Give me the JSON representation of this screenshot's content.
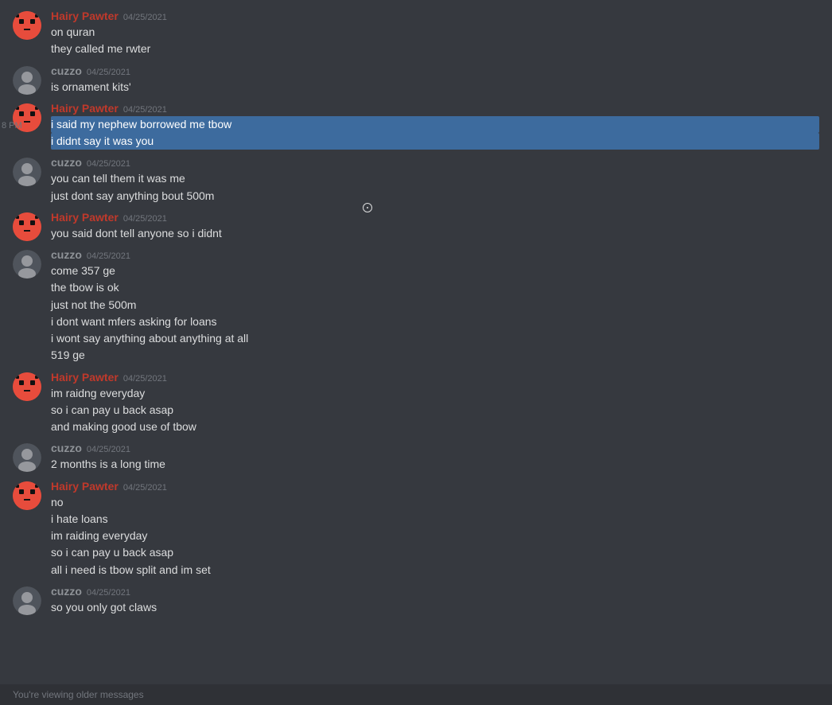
{
  "colors": {
    "bg": "#36393f",
    "sidebar_bg": "#2f3136",
    "text_primary": "#dcddde",
    "text_muted": "#72767d",
    "username_hairy": "#c0392b",
    "username_cuzzo": "#8e9297",
    "selected_bg": "#3d6b9e"
  },
  "messages": [
    {
      "id": "msg1",
      "author": "Hairy Pawter",
      "author_type": "hairy",
      "timestamp": "04/25/2021",
      "lines": [
        "on quran",
        "they called me rwter"
      ]
    },
    {
      "id": "msg2",
      "author": "cuzzo",
      "author_type": "cuzzo",
      "timestamp": "04/25/2021",
      "lines": [
        "is ornament kits'"
      ]
    },
    {
      "id": "msg3",
      "author": "Hairy Pawter",
      "author_type": "hairy",
      "timestamp": "04/25/2021",
      "lines": [
        "i said my nephew borrowed me tbow",
        "i didnt say it was you"
      ],
      "selected_lines": [
        0,
        1
      ]
    },
    {
      "id": "msg4",
      "author": "cuzzo",
      "author_type": "cuzzo",
      "timestamp": "04/25/2021",
      "lines": [
        "you can tell them it was me",
        "just dont say anything bout 500m"
      ]
    },
    {
      "id": "msg5",
      "author": "Hairy Pawter",
      "author_type": "hairy",
      "timestamp": "04/25/2021",
      "lines": [
        "you said dont tell anyone so i didnt"
      ]
    },
    {
      "id": "msg6",
      "author": "cuzzo",
      "author_type": "cuzzo",
      "timestamp": "04/25/2021",
      "lines": [
        "come 357 ge",
        "the tbow is ok",
        "just not the 500m",
        "i dont want mfers asking for loans",
        "i wont say anything about anything at all",
        "519 ge"
      ]
    },
    {
      "id": "msg7",
      "author": "Hairy Pawter",
      "author_type": "hairy",
      "timestamp": "04/25/2021",
      "lines": [
        "im raidng everyday",
        "so i can pay u back asap",
        "and making good use of tbow"
      ]
    },
    {
      "id": "msg8",
      "author": "cuzzo",
      "author_type": "cuzzo",
      "timestamp": "04/25/2021",
      "lines": [
        "2 months is a long time"
      ]
    },
    {
      "id": "msg9",
      "author": "Hairy Pawter",
      "author_type": "hairy",
      "timestamp": "04/25/2021",
      "lines": [
        "no",
        "i hate loans",
        "im raiding everyday",
        "so i can pay u back asap",
        "all i need is tbow split and im set"
      ]
    },
    {
      "id": "msg10",
      "author": "cuzzo",
      "author_type": "cuzzo",
      "timestamp": "04/25/2021",
      "lines": [
        "so you only got claws"
      ]
    }
  ],
  "status_bar": {
    "text": "You're viewing older messages"
  },
  "time_label": "8 PM"
}
